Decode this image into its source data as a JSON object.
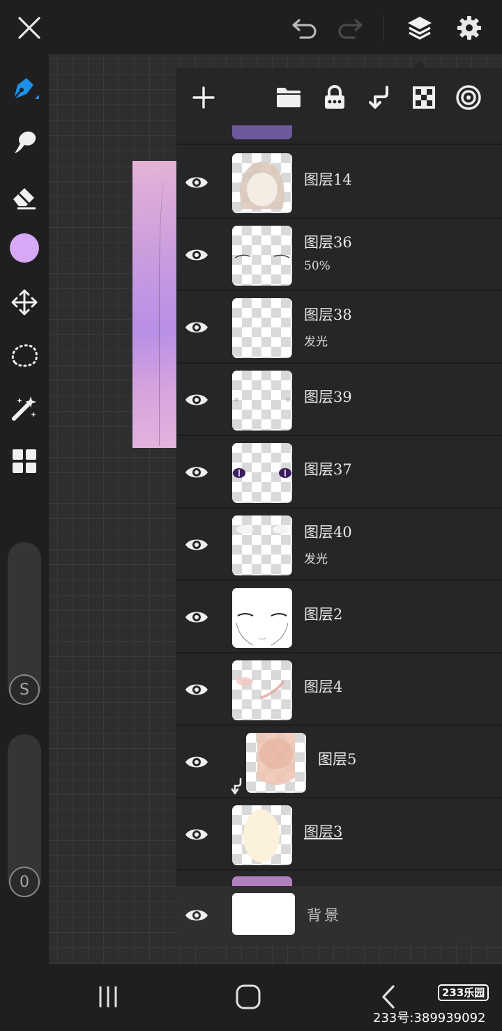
{
  "topbar": {
    "close_icon": "close-icon",
    "undo_icon": "undo-icon",
    "redo_icon": "redo-icon",
    "layers_icon": "layers-icon",
    "settings_icon": "gear-icon"
  },
  "tools": {
    "items": [
      "pen-icon",
      "smudge-icon",
      "eraser-icon",
      "color-swatch",
      "transform-icon",
      "lasso-icon",
      "magic-wand-icon",
      "grid-icon"
    ],
    "active_color": "#d6a8f5",
    "accent": "#1e8fe6"
  },
  "sliders": {
    "size_badge": "S",
    "opacity_badge": "0"
  },
  "layers_panel": {
    "toolbar": [
      "add-icon",
      "folder-icon",
      "lock-icon",
      "merge-down-icon",
      "checker-icon",
      "target-icon"
    ],
    "layers": [
      {
        "name": "图层14",
        "sub": ""
      },
      {
        "name": "图层36",
        "sub": "50%"
      },
      {
        "name": "图层38",
        "sub": "发光"
      },
      {
        "name": "图层39",
        "sub": ""
      },
      {
        "name": "图层37",
        "sub": ""
      },
      {
        "name": "图层40",
        "sub": "发光"
      },
      {
        "name": "图层2",
        "sub": ""
      },
      {
        "name": "图层4",
        "sub": ""
      },
      {
        "name": "图层5",
        "sub": ""
      },
      {
        "name": "图层3",
        "sub": ""
      }
    ],
    "background_layer": "背景"
  },
  "navbar": {
    "recent_icon": "recent-apps-icon",
    "home_icon": "home-icon",
    "back_icon": "back-icon"
  },
  "watermark": {
    "logo": "233乐园",
    "text": "233号:389939092"
  }
}
